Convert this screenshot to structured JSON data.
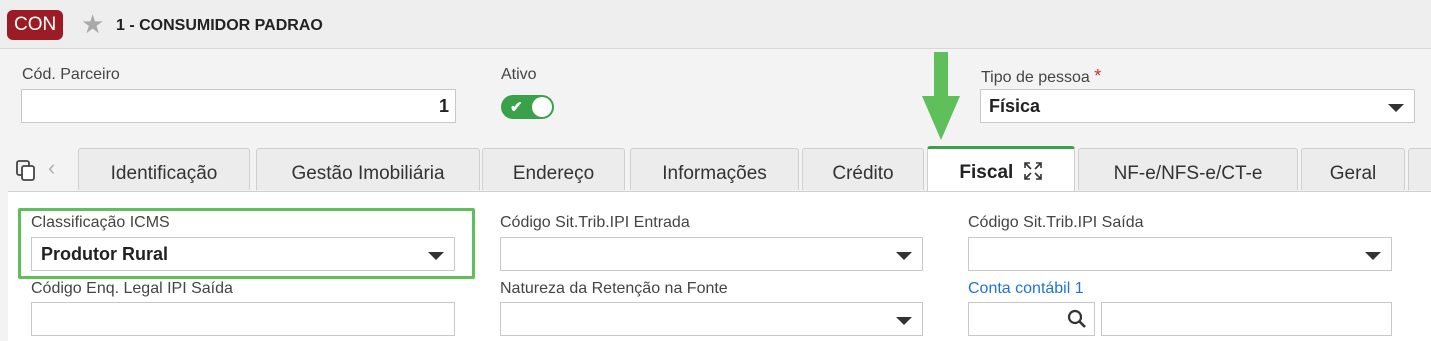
{
  "header": {
    "badge": "CON",
    "title": "1 - CONSUMIDOR PADRAO"
  },
  "form": {
    "cod_parceiro_label": "Cód. Parceiro",
    "cod_parceiro_value": "1",
    "ativo_label": "Ativo",
    "ativo_checked": true,
    "tipo_pessoa_label": "Tipo de pessoa",
    "tipo_pessoa_required": "*",
    "tipo_pessoa_value": "Física"
  },
  "tabs": [
    {
      "label": "Identificação"
    },
    {
      "label": "Gestão Imobiliária"
    },
    {
      "label": "Endereço"
    },
    {
      "label": "Informações"
    },
    {
      "label": "Crédito"
    },
    {
      "label": "Fiscal"
    },
    {
      "label": "NF-e/NFS-e/CT-e"
    },
    {
      "label": "Geral"
    }
  ],
  "fiscal": {
    "classificacao_icms_label": "Classificação ICMS",
    "classificacao_icms_value": "Produtor Rural",
    "cod_sit_trib_ipi_entrada_label": "Código Sit.Trib.IPI Entrada",
    "cod_sit_trib_ipi_entrada_value": "",
    "cod_sit_trib_ipi_saida_label": "Código Sit.Trib.IPI Saída",
    "cod_sit_trib_ipi_saida_value": "",
    "cod_enq_legal_label": "Código Enq. Legal IPI Saída",
    "cod_enq_legal_value": "",
    "natureza_retencao_label": "Natureza da Retenção na Fonte",
    "natureza_retencao_value": "",
    "conta_contabil_label": "Conta contábil 1",
    "conta_contabil_code": "",
    "conta_contabil_desc": ""
  },
  "colors": {
    "accent_green": "#3aa14a",
    "highlight_green": "#5fc05b",
    "badge_red": "#9b1c24",
    "link_blue": "#1f74d1"
  },
  "icons": [
    "star-icon",
    "check-icon",
    "caret-down-icon",
    "copy-icon",
    "chevron-left-icon",
    "expand-icon",
    "search-icon",
    "arrow-down-icon"
  ]
}
